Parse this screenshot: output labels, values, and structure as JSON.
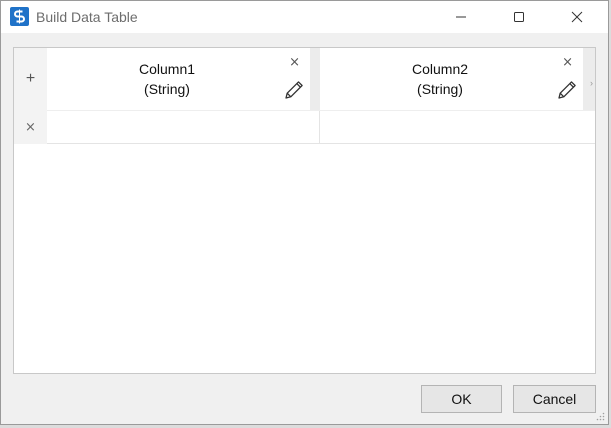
{
  "window": {
    "title": "Build Data Table",
    "app_icon": "s-logo-icon",
    "controls": [
      "minimize-icon",
      "maximize-icon",
      "close-icon"
    ]
  },
  "grid": {
    "add_row_symbol": "+",
    "delete_row_symbol": "×",
    "columns": [
      {
        "name": "Column1",
        "type": "(String)",
        "delete_symbol": "×",
        "edit_icon": "pencil-icon"
      },
      {
        "name": "Column2",
        "type": "(String)",
        "delete_symbol": "×",
        "edit_icon": "pencil-icon"
      }
    ],
    "rows": [
      [
        "",
        ""
      ]
    ]
  },
  "buttons": {
    "ok_label": "OK",
    "cancel_label": "Cancel"
  },
  "colors": {
    "accent": "#1f72c8",
    "background": "#f0f0f0",
    "grid_background": "#ffffff"
  }
}
